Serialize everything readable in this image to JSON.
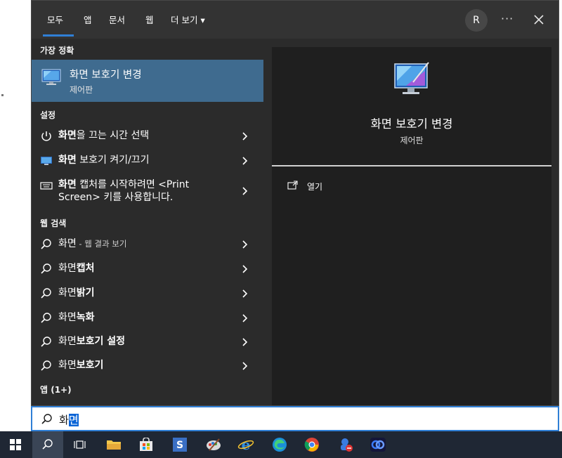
{
  "tabs": [
    {
      "label": "모두"
    },
    {
      "label": "앱"
    },
    {
      "label": "문서"
    },
    {
      "label": "웹"
    },
    {
      "label": "더 보기 ▾"
    }
  ],
  "user_initial": "R",
  "more_options": "···",
  "sections": {
    "best_match": "가장 정확",
    "settings": "설정",
    "web_search": "웹 검색",
    "apps": "앱 (1+)"
  },
  "best_match": {
    "title": "화면 보호기 변경",
    "subtitle": "제어판"
  },
  "settings_items": [
    {
      "bold": "화면",
      "rest": "을 끄는 시간 선택"
    },
    {
      "bold": "화면",
      "rest": " 보호기 켜기/끄기"
    },
    {
      "bold": "화면",
      "rest": " 캡처를 시작하려면 <Print",
      "line2": "Screen> 키를 사용합니다."
    }
  ],
  "web_items": [
    {
      "prefix": "화면",
      "bold": "",
      "hint": " - 웹 결과 보기"
    },
    {
      "prefix": "화면",
      "bold": "캡처",
      "hint": ""
    },
    {
      "prefix": "화면",
      "bold": "밝기",
      "hint": ""
    },
    {
      "prefix": "화면",
      "bold": "녹화",
      "hint": ""
    },
    {
      "prefix": "화면",
      "bold": "보호기 설정",
      "hint": ""
    },
    {
      "prefix": "화면",
      "bold": "보호기",
      "hint": ""
    }
  ],
  "detail": {
    "title": "화면 보호기 변경",
    "subtitle": "제어판",
    "open_label": "열기"
  },
  "search": {
    "typed": "화",
    "selected": "면"
  },
  "colors": {
    "accent": "#2f7fd6",
    "highlight": "#3f6b8f",
    "taskbar": "#1f2734"
  }
}
